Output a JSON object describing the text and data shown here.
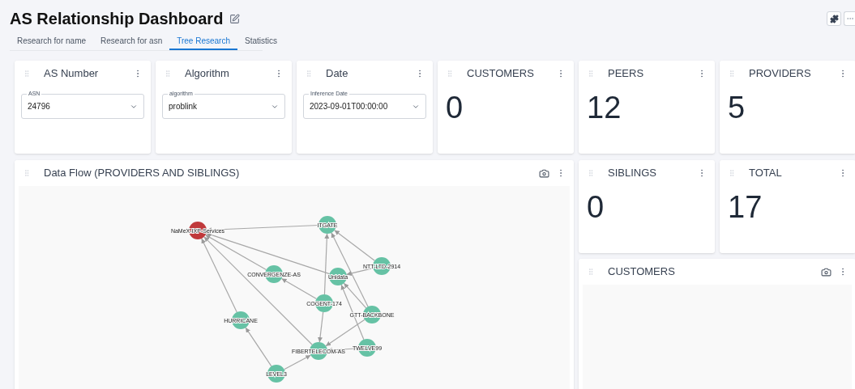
{
  "title": "AS Relationship Dashboard",
  "tabs": [
    {
      "label": "Research for name",
      "selected": false
    },
    {
      "label": "Research for asn",
      "selected": false
    },
    {
      "label": "Tree Research",
      "selected": true
    },
    {
      "label": "Statistics",
      "selected": false
    }
  ],
  "filters": [
    {
      "title": "AS Number",
      "field_label": "ASN",
      "value": "24796"
    },
    {
      "title": "Algorithm",
      "field_label": "algorithm",
      "value": "problink"
    },
    {
      "title": "Date",
      "field_label": "Inference Date",
      "value": "2023-09-01T00:00:00"
    }
  ],
  "stats": [
    {
      "title": "CUSTOMERS",
      "value": "0"
    },
    {
      "title": "PEERS",
      "value": "12"
    },
    {
      "title": "PROVIDERS",
      "value": "5"
    }
  ],
  "flow_panel": {
    "title": "Data Flow (PROVIDERS AND SIBLINGS)",
    "nodes": [
      {
        "label": "NaMeX-IXP-Services",
        "color": "#c0393b"
      },
      {
        "label": "ITGATE",
        "color": "#66c2a5"
      },
      {
        "label": "NTT-LTD-2914",
        "color": "#66c2a5"
      },
      {
        "label": "Unidata",
        "color": "#66c2a5"
      },
      {
        "label": "CONVERGENZE-AS",
        "color": "#66c2a5"
      },
      {
        "label": "COGENT-174",
        "color": "#66c2a5"
      },
      {
        "label": "GTT-BACKBONE",
        "color": "#66c2a5"
      },
      {
        "label": "HURRICANE",
        "color": "#66c2a5"
      },
      {
        "label": "FIBERTELECOM-AS",
        "color": "#66c2a5"
      },
      {
        "label": "TWELVE99",
        "color": "#66c2a5"
      },
      {
        "label": "LEVEL3",
        "color": "#66c2a5"
      }
    ]
  },
  "side_stats": [
    {
      "title": "SIBLINGS",
      "value": "0"
    },
    {
      "title": "TOTAL",
      "value": "17"
    }
  ],
  "customers_panel": {
    "title": "CUSTOMERS"
  }
}
